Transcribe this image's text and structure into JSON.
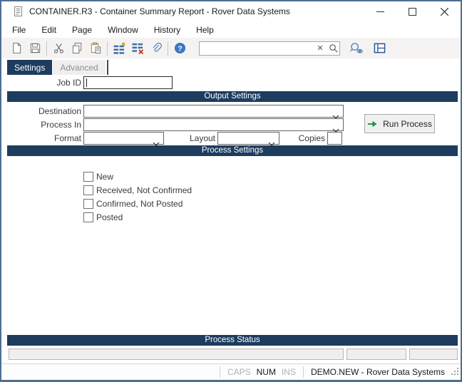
{
  "colors": {
    "header_navy": "#1d3c5e",
    "window_border": "#4d6e92",
    "run_arrow_green": "#149a43",
    "icon_blue": "#3a6ea5",
    "help_blue": "#3b78c3"
  },
  "window": {
    "title": "CONTAINER.R3 - Container Summary Report - Rover Data Systems"
  },
  "menu": {
    "items": [
      "File",
      "Edit",
      "Page",
      "Window",
      "History",
      "Help"
    ]
  },
  "toolbar": {
    "search_value": ""
  },
  "tabs": {
    "settings": "Settings",
    "advanced": "Advanced"
  },
  "form": {
    "job_id_label": "Job ID",
    "job_id_value": "",
    "output": {
      "title": "Output Settings",
      "destination_label": "Destination",
      "destination_value": "",
      "process_in_label": "Process In",
      "process_in_value": "",
      "format_label": "Format",
      "format_value": "",
      "layout_label": "Layout",
      "layout_value": "",
      "copies_label": "Copies",
      "copies_value": ""
    },
    "run_button_label": "Run Process",
    "process": {
      "title": "Process Settings",
      "checkboxes": [
        "New",
        "Received, Not Confirmed",
        "Confirmed, Not Posted",
        "Posted"
      ],
      "checked": [
        false,
        false,
        false,
        false
      ]
    },
    "status": {
      "title": "Process Status",
      "fields": [
        "",
        "",
        ""
      ]
    }
  },
  "statusbar": {
    "caps": "CAPS",
    "num": "NUM",
    "ins": "INS",
    "context": "DEMO.NEW - Rover Data Systems"
  }
}
